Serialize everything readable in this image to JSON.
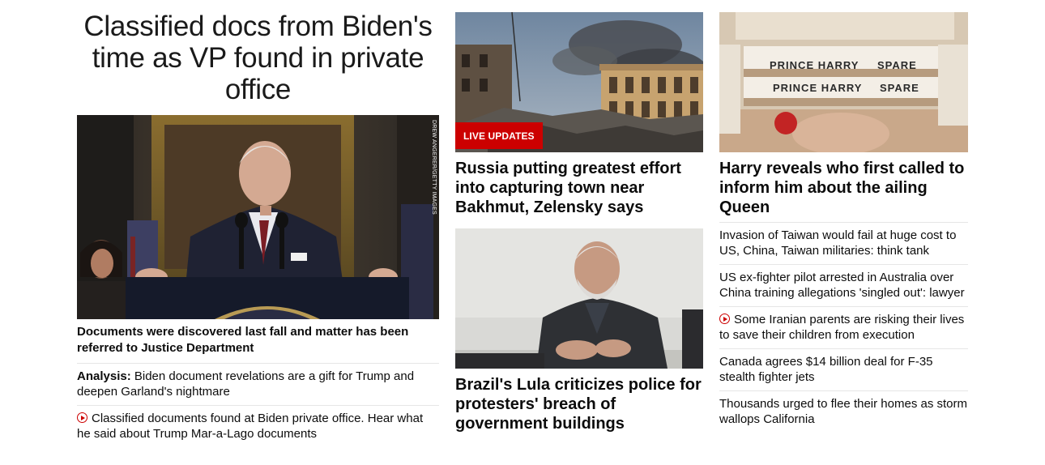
{
  "left": {
    "headline": "Classified docs from Biden's time as VP found in private office",
    "photo_credit": "DREW ANGERER/GETTY IMAGES",
    "subheadline": "Documents were discovered last fall and matter has been referred to Justice Department",
    "links": [
      {
        "prefix": "Analysis:",
        "text": "Biden document revelations are a gift for Trump and deepen Garland's nightmare"
      },
      {
        "video": true,
        "text": "Classified documents found at Biden private office. Hear what he said about Trump Mar-a-Lago documents"
      }
    ]
  },
  "middle": {
    "card1": {
      "badge": "LIVE UPDATES",
      "title": "Russia putting greatest effort into capturing town near Bakhmut, Zelensky says"
    },
    "card2": {
      "title": "Brazil's Lula criticizes police for protesters' breach of government buildings"
    }
  },
  "right": {
    "card": {
      "title": "Harry reveals who first called to inform him about the ailing Queen"
    },
    "book_labels": [
      "PRINCE HARRY",
      "SPARE"
    ],
    "links": [
      {
        "text": "Invasion of Taiwan would fail at huge cost to US, China, Taiwan militaries: think tank"
      },
      {
        "text": "US ex-fighter pilot arrested in Australia over China training allegations 'singled out': lawyer"
      },
      {
        "video": true,
        "text": "Some Iranian parents are risking their lives to save their children from execution"
      },
      {
        "text": "Canada agrees $14 billion deal for F-35 stealth fighter jets"
      },
      {
        "text": "Thousands urged to flee their homes as storm wallops California"
      }
    ]
  },
  "colors": {
    "accent": "#cc0000",
    "text": "#0c0c0c",
    "divider": "#e6e6e6"
  }
}
